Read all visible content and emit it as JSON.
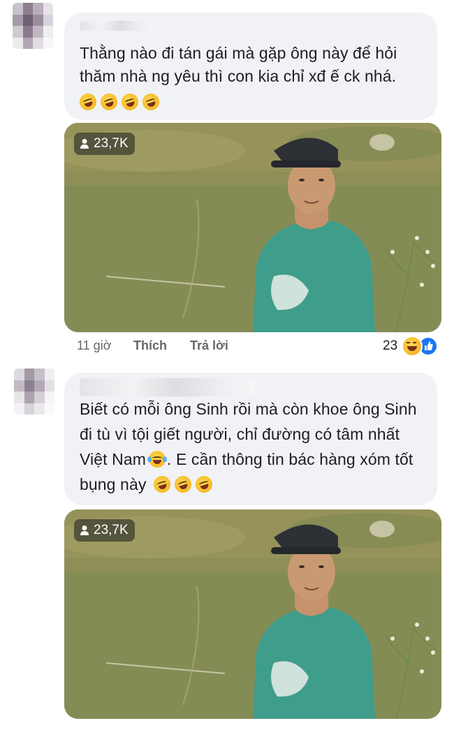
{
  "comments": [
    {
      "text": "Thằng nào đi tán gái mà gặp ông này để hỏi thăm nhà ng yêu thì con kia chỉ xđ ế ck nhá.",
      "emojis": [
        "rolling-on-floor-laughing",
        "rolling-on-floor-laughing",
        "rolling-on-floor-laughing",
        "rolling-on-floor-laughing"
      ],
      "photo_views": "23,7K",
      "time": "11 giờ",
      "like_label": "Thích",
      "reply_label": "Trả lời",
      "reaction_count": "23"
    },
    {
      "text_before_emoji": "Biết có mỗi ông Sinh rồi mà còn khoe ông Sinh đi tù vì tội giết người, chỉ đường có tâm nhất Việt Nam",
      "text_after_emoji": ". E cần thông tin bác hàng xóm tốt bụng này",
      "inline_emoji": "face-with-tears-of-joy",
      "emojis": [
        "rolling-on-floor-laughing",
        "rolling-on-floor-laughing",
        "rolling-on-floor-laughing"
      ],
      "photo_views": "23,7K"
    }
  ],
  "colors": {
    "bubble": "#f0f2f5",
    "text": "#1c1e21",
    "meta": "#65676b",
    "like_blue": "#1877f2"
  }
}
